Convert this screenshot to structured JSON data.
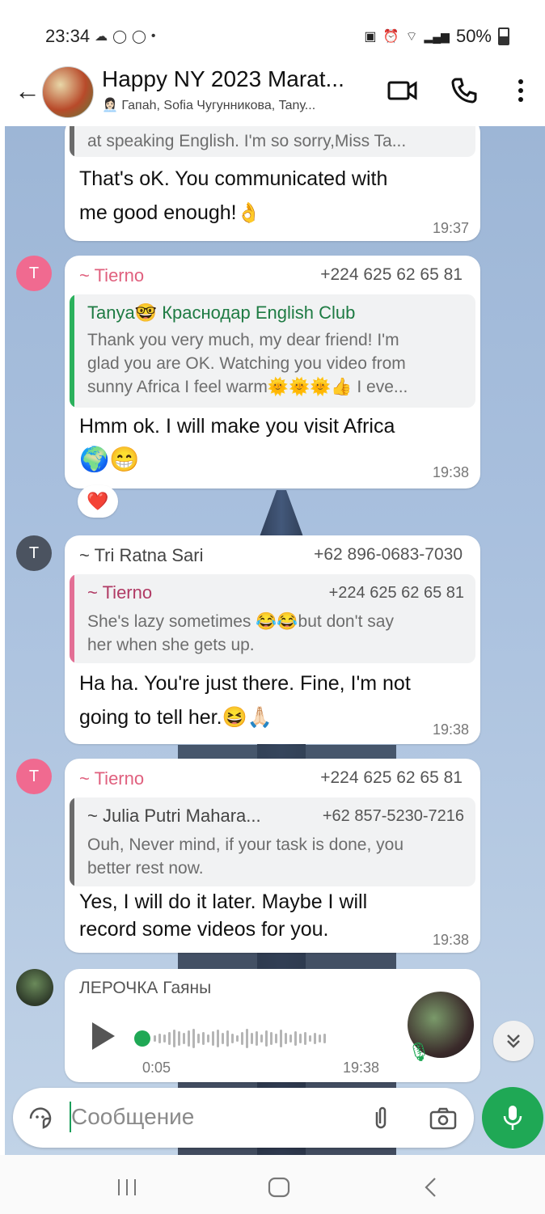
{
  "status_bar": {
    "time": "23:34",
    "dot": "•",
    "battery": "50%"
  },
  "header": {
    "title": "Happy NY 2023 Marat...",
    "subtitle": "Гапаһ, Sofia Чугунникова, Tanу..."
  },
  "messages": [
    {
      "partial_quote": "at speaking English. I'm so sorry,Miss Ta...",
      "text_1": "That's oK. You communicated with",
      "text_2": "me good enough!",
      "emoji": "👌",
      "time": "19:37"
    },
    {
      "avatar_letter": "T",
      "sender": "~ Tierno",
      "phone": "+224 625 62 65 81",
      "quote_name": "Tanya🤓 Краснодар English Club",
      "quote_1": "Thank you very much, my dear friend! I'm",
      "quote_2": "glad you are OK. Watching you video from",
      "quote_3": "sunny Africa I feel warm🌞🌞🌞👍 I eve...",
      "text_1": "Hmm ok. I will make you visit Africa",
      "text_2": "🌍😁",
      "time": "19:38",
      "reaction": "❤️"
    },
    {
      "avatar_letter": "T",
      "sender": "~ Tri Ratna Sari",
      "phone": "+62 896-0683-7030",
      "quote_name": "~ Tierno",
      "quote_phone": "+224 625 62 65 81",
      "quote_1": "She's lazy sometimes 😂😂but don't say",
      "quote_2": "her when she gets up.",
      "text_1": "Ha ha. You're just there. Fine, I'm not",
      "text_2": "going to tell her.😆🙏🏻",
      "time": "19:38"
    },
    {
      "avatar_letter": "T",
      "sender": "~ Tierno",
      "phone": "+224 625 62 65 81",
      "quote_name": "~ Julia Putri Mahara...",
      "quote_phone": "+62 857-5230-7216",
      "quote_1": "Ouh, Never mind, if your task is done, you",
      "quote_2": "better rest now.",
      "text_1": "Yes, I will do it later. Maybe I will",
      "text_2": "record some videos for you.",
      "time": "19:38"
    },
    {
      "sender": "ЛЕРОЧКА Гаяны",
      "duration": "0:05",
      "time": "19:38",
      "progress": 0
    }
  ],
  "input": {
    "placeholder": "Сообщение"
  },
  "colors": {
    "accent": "#1fa855",
    "tierno": "#e0607e",
    "quote_bar_green": "#2bb15c",
    "quote_bar_pink": "#e36f95",
    "quote_bar_gray": "#6b6b6b"
  }
}
